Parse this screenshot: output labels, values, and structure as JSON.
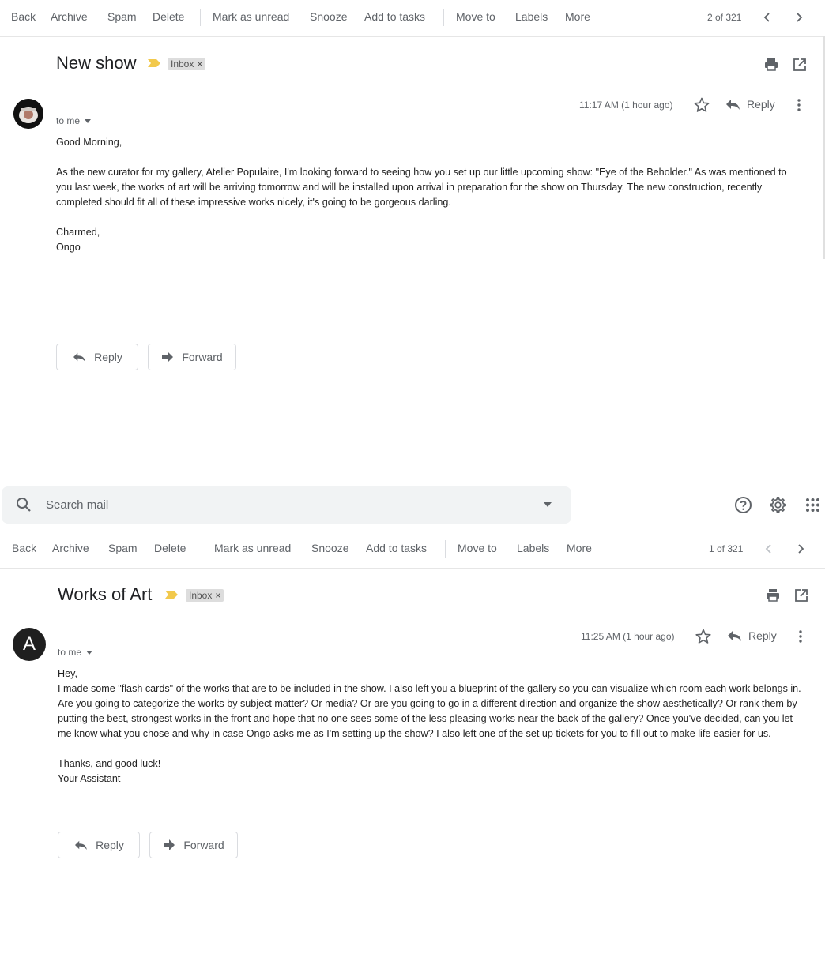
{
  "toolbar": {
    "back": "Back",
    "archive": "Archive",
    "spam": "Spam",
    "delete": "Delete",
    "mark_unread": "Mark as unread",
    "snooze": "Snooze",
    "add_tasks": "Add to tasks",
    "move_to": "Move to",
    "labels": "Labels",
    "more": "More"
  },
  "email1": {
    "counter": "2 of 321",
    "subject": "New show",
    "label": "Inbox",
    "label_close": "×",
    "time": "11:17 AM (1 hour ago)",
    "reply_label": "Reply",
    "to": "to me",
    "body": [
      "Good Morning,",
      "",
      "As the new curator for my gallery, Atelier Populaire, I'm looking forward to seeing how you set up our little upcoming show: \"Eye of the Beholder.\" As was mentioned to you last week, the works of art will be arriving tomorrow and will be installed upon arrival in preparation for the show on Thursday. The new construction,  recently completed should fit all of these impressive works nicely, it's going to be gorgeous darling.",
      "",
      "Charmed,",
      "Ongo"
    ],
    "reply_button": "Reply",
    "forward_button": "Forward"
  },
  "search": {
    "placeholder": "Search mail"
  },
  "email2": {
    "counter": "1 of 321",
    "subject": "Works of Art",
    "label": "Inbox",
    "label_close": "×",
    "avatar_letter": "A",
    "time": "11:25 AM (1 hour ago)",
    "reply_label": "Reply",
    "to": "to me",
    "body": [
      "Hey,",
      "I made some \"flash cards\" of the works that are to be included in the show. I also left you a blueprint of the gallery so you can visualize which room each work belongs in. Are you going to categorize the works by subject matter? Or media? Or are you going to go in a different direction and organize the show aesthetically? Or rank them by putting the best, strongest works in the front and hope that no one sees some of the less pleasing works near the back of the gallery? Once you've decided, can you let me know what you chose and why in case Ongo asks me as I'm setting up the show? I also left one of the set up tickets for you to fill out to make life easier for us.",
      "",
      "Thanks, and good luck!",
      "Your Assistant"
    ],
    "reply_button": "Reply",
    "forward_button": "Forward"
  },
  "colors": {
    "important_marker": "#f2c94c",
    "avatar_dark": "#1f1f1f"
  }
}
